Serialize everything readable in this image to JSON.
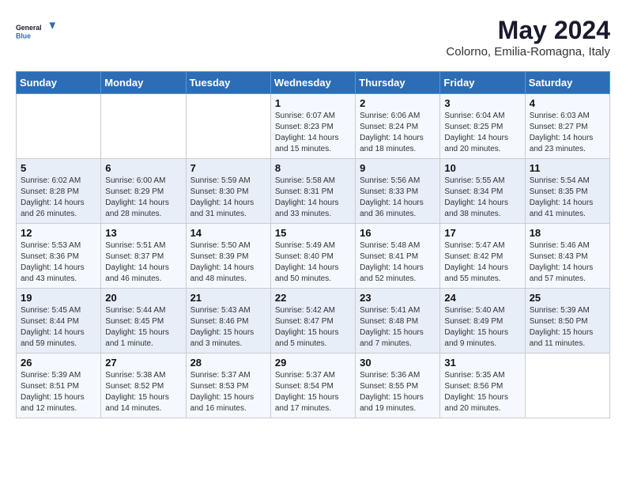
{
  "logo": {
    "line1": "General",
    "line2": "Blue"
  },
  "title": "May 2024",
  "location": "Colorno, Emilia-Romagna, Italy",
  "days_header": [
    "Sunday",
    "Monday",
    "Tuesday",
    "Wednesday",
    "Thursday",
    "Friday",
    "Saturday"
  ],
  "weeks": [
    [
      {
        "num": "",
        "info": ""
      },
      {
        "num": "",
        "info": ""
      },
      {
        "num": "",
        "info": ""
      },
      {
        "num": "1",
        "info": "Sunrise: 6:07 AM\nSunset: 8:23 PM\nDaylight: 14 hours\nand 15 minutes."
      },
      {
        "num": "2",
        "info": "Sunrise: 6:06 AM\nSunset: 8:24 PM\nDaylight: 14 hours\nand 18 minutes."
      },
      {
        "num": "3",
        "info": "Sunrise: 6:04 AM\nSunset: 8:25 PM\nDaylight: 14 hours\nand 20 minutes."
      },
      {
        "num": "4",
        "info": "Sunrise: 6:03 AM\nSunset: 8:27 PM\nDaylight: 14 hours\nand 23 minutes."
      }
    ],
    [
      {
        "num": "5",
        "info": "Sunrise: 6:02 AM\nSunset: 8:28 PM\nDaylight: 14 hours\nand 26 minutes."
      },
      {
        "num": "6",
        "info": "Sunrise: 6:00 AM\nSunset: 8:29 PM\nDaylight: 14 hours\nand 28 minutes."
      },
      {
        "num": "7",
        "info": "Sunrise: 5:59 AM\nSunset: 8:30 PM\nDaylight: 14 hours\nand 31 minutes."
      },
      {
        "num": "8",
        "info": "Sunrise: 5:58 AM\nSunset: 8:31 PM\nDaylight: 14 hours\nand 33 minutes."
      },
      {
        "num": "9",
        "info": "Sunrise: 5:56 AM\nSunset: 8:33 PM\nDaylight: 14 hours\nand 36 minutes."
      },
      {
        "num": "10",
        "info": "Sunrise: 5:55 AM\nSunset: 8:34 PM\nDaylight: 14 hours\nand 38 minutes."
      },
      {
        "num": "11",
        "info": "Sunrise: 5:54 AM\nSunset: 8:35 PM\nDaylight: 14 hours\nand 41 minutes."
      }
    ],
    [
      {
        "num": "12",
        "info": "Sunrise: 5:53 AM\nSunset: 8:36 PM\nDaylight: 14 hours\nand 43 minutes."
      },
      {
        "num": "13",
        "info": "Sunrise: 5:51 AM\nSunset: 8:37 PM\nDaylight: 14 hours\nand 46 minutes."
      },
      {
        "num": "14",
        "info": "Sunrise: 5:50 AM\nSunset: 8:39 PM\nDaylight: 14 hours\nand 48 minutes."
      },
      {
        "num": "15",
        "info": "Sunrise: 5:49 AM\nSunset: 8:40 PM\nDaylight: 14 hours\nand 50 minutes."
      },
      {
        "num": "16",
        "info": "Sunrise: 5:48 AM\nSunset: 8:41 PM\nDaylight: 14 hours\nand 52 minutes."
      },
      {
        "num": "17",
        "info": "Sunrise: 5:47 AM\nSunset: 8:42 PM\nDaylight: 14 hours\nand 55 minutes."
      },
      {
        "num": "18",
        "info": "Sunrise: 5:46 AM\nSunset: 8:43 PM\nDaylight: 14 hours\nand 57 minutes."
      }
    ],
    [
      {
        "num": "19",
        "info": "Sunrise: 5:45 AM\nSunset: 8:44 PM\nDaylight: 14 hours\nand 59 minutes."
      },
      {
        "num": "20",
        "info": "Sunrise: 5:44 AM\nSunset: 8:45 PM\nDaylight: 15 hours\nand 1 minute."
      },
      {
        "num": "21",
        "info": "Sunrise: 5:43 AM\nSunset: 8:46 PM\nDaylight: 15 hours\nand 3 minutes."
      },
      {
        "num": "22",
        "info": "Sunrise: 5:42 AM\nSunset: 8:47 PM\nDaylight: 15 hours\nand 5 minutes."
      },
      {
        "num": "23",
        "info": "Sunrise: 5:41 AM\nSunset: 8:48 PM\nDaylight: 15 hours\nand 7 minutes."
      },
      {
        "num": "24",
        "info": "Sunrise: 5:40 AM\nSunset: 8:49 PM\nDaylight: 15 hours\nand 9 minutes."
      },
      {
        "num": "25",
        "info": "Sunrise: 5:39 AM\nSunset: 8:50 PM\nDaylight: 15 hours\nand 11 minutes."
      }
    ],
    [
      {
        "num": "26",
        "info": "Sunrise: 5:39 AM\nSunset: 8:51 PM\nDaylight: 15 hours\nand 12 minutes."
      },
      {
        "num": "27",
        "info": "Sunrise: 5:38 AM\nSunset: 8:52 PM\nDaylight: 15 hours\nand 14 minutes."
      },
      {
        "num": "28",
        "info": "Sunrise: 5:37 AM\nSunset: 8:53 PM\nDaylight: 15 hours\nand 16 minutes."
      },
      {
        "num": "29",
        "info": "Sunrise: 5:37 AM\nSunset: 8:54 PM\nDaylight: 15 hours\nand 17 minutes."
      },
      {
        "num": "30",
        "info": "Sunrise: 5:36 AM\nSunset: 8:55 PM\nDaylight: 15 hours\nand 19 minutes."
      },
      {
        "num": "31",
        "info": "Sunrise: 5:35 AM\nSunset: 8:56 PM\nDaylight: 15 hours\nand 20 minutes."
      },
      {
        "num": "",
        "info": ""
      }
    ]
  ]
}
